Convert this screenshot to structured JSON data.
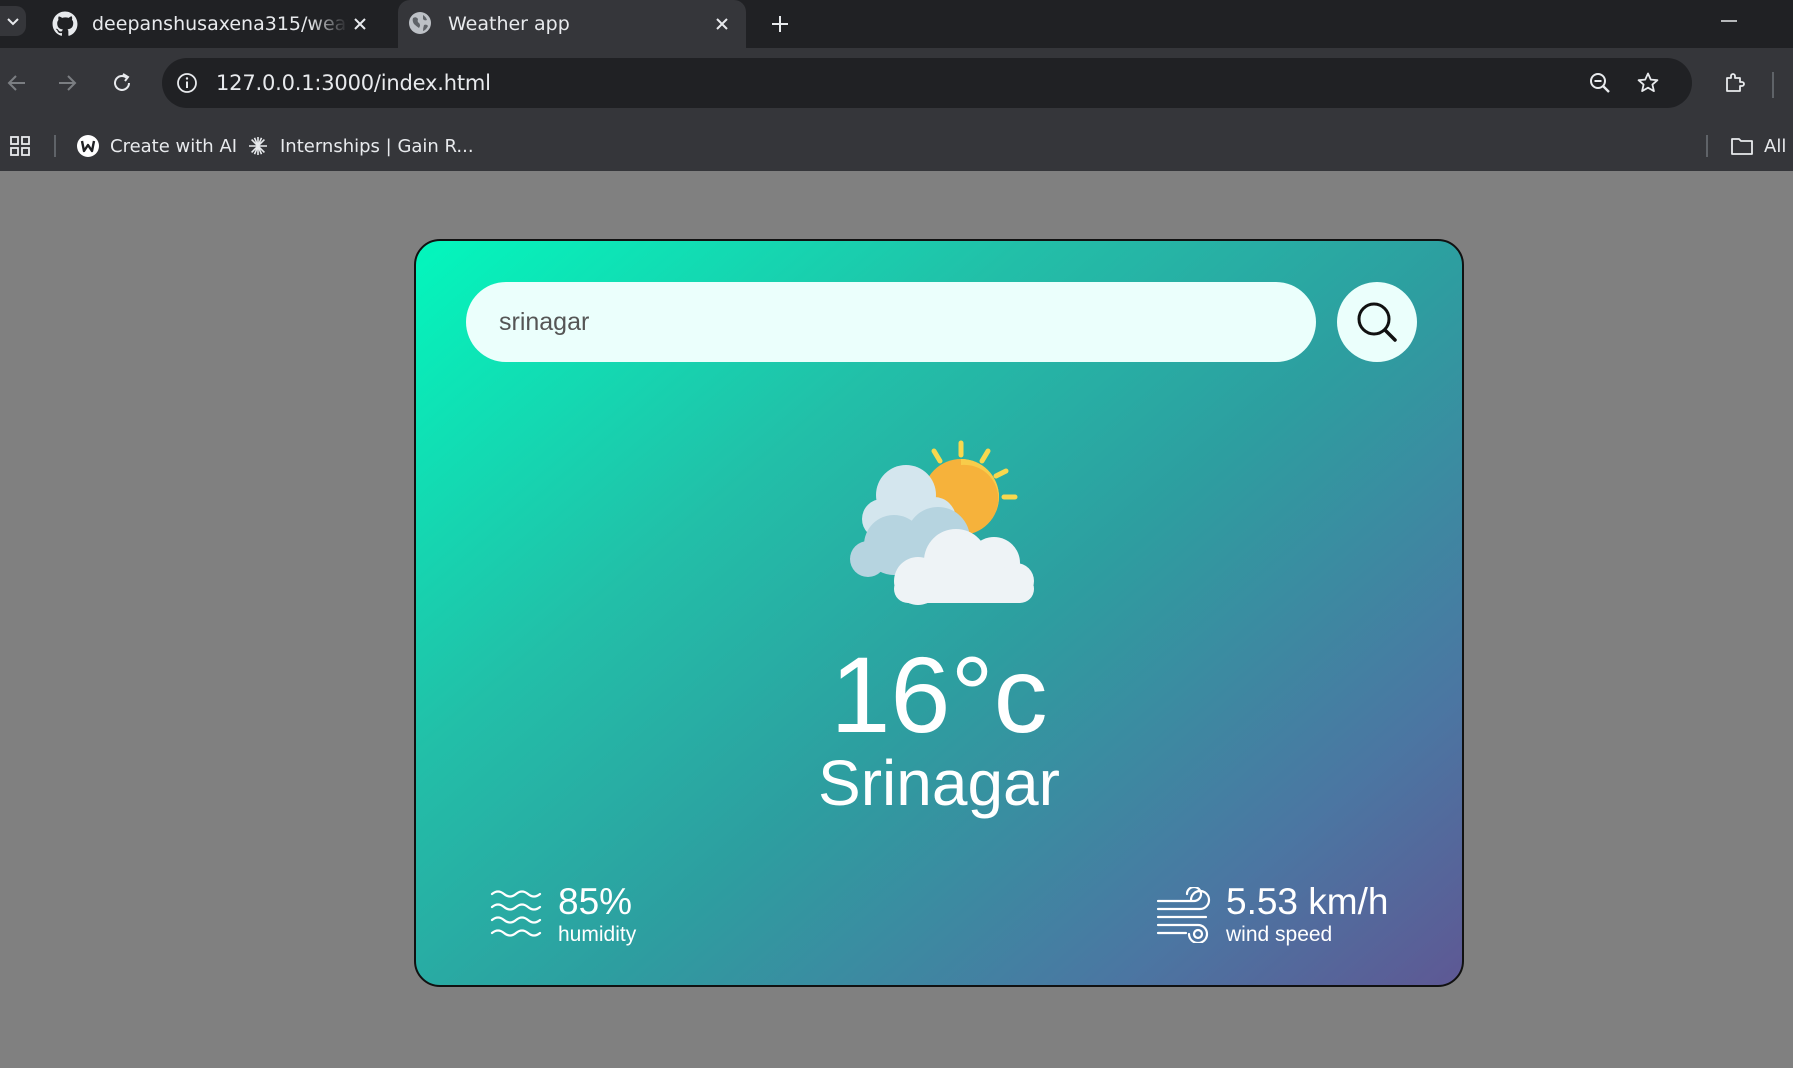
{
  "browser": {
    "tabs": [
      {
        "title": "deepanshusaxena315/weather-app",
        "icon": "github-icon",
        "active": false
      },
      {
        "title": "Weather app",
        "icon": "globe-icon",
        "active": true
      }
    ],
    "url": "127.0.0.1:3000/index.html",
    "bookmarks": [
      {
        "label": "Create with AI",
        "icon": "ai-logo-icon"
      },
      {
        "label": "Internships | Gain R...",
        "icon": "asterisk-icon"
      }
    ],
    "all_bookmarks_label": "All"
  },
  "search": {
    "value": "srinagar",
    "icon": "search-icon"
  },
  "weather": {
    "icon": "partly-cloudy-icon",
    "temperature": "16°c",
    "city": "Srinagar"
  },
  "details": {
    "humidity": {
      "value": "85%",
      "label": "humidity",
      "icon": "waves-icon"
    },
    "wind": {
      "value": "5.53 km/h",
      "label": "wind speed",
      "icon": "wind-icon"
    }
  },
  "colors": {
    "page_background": "#808080",
    "card_gradient_start": "#03f7bd",
    "card_gradient_end": "#5e5894",
    "input_background": "#ebfffc",
    "text": "#ffffff"
  }
}
